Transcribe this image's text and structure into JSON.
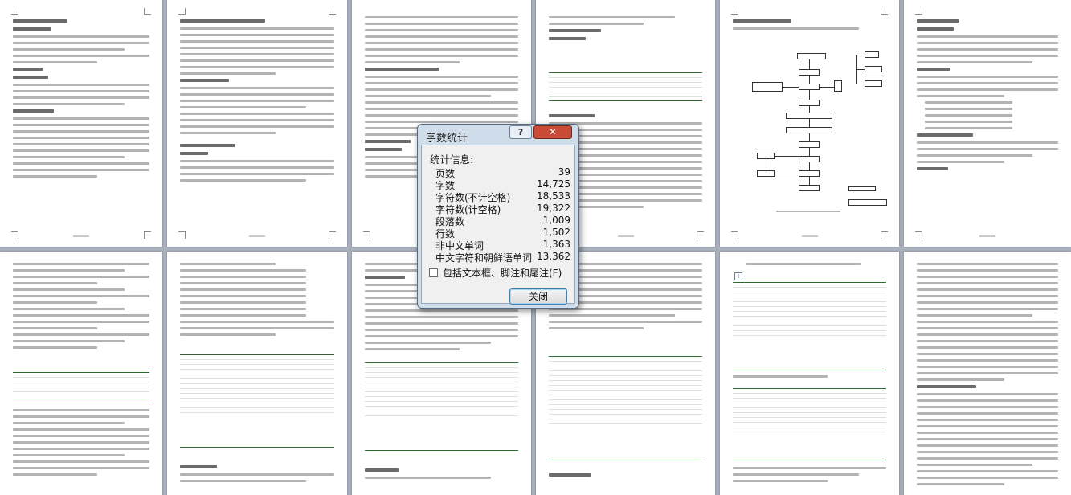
{
  "dialog": {
    "title": "字数统计",
    "help_label": "?",
    "close_icon_label": "✕",
    "section_heading": "统计信息:",
    "stats": [
      {
        "label": "页数",
        "value": "39"
      },
      {
        "label": "字数",
        "value": "14,725"
      },
      {
        "label": "字符数(不计空格)",
        "value": "18,533"
      },
      {
        "label": "字符数(计空格)",
        "value": "19,322"
      },
      {
        "label": "段落数",
        "value": "1,009"
      },
      {
        "label": "行数",
        "value": "1,502"
      },
      {
        "label": "非中文单词",
        "value": "1,363"
      },
      {
        "label": "中文字符和朝鲜语单词",
        "value": "13,362"
      }
    ],
    "checkbox_label": "包括文本框、脚注和尾注(F)",
    "checkbox_checked": false,
    "close_button_label": "关闭"
  },
  "colors": {
    "background": "#aab1bd",
    "dialog_frame": "#cfdcea",
    "close_red": "#c94a35",
    "table_border": "#2f6b2f"
  }
}
